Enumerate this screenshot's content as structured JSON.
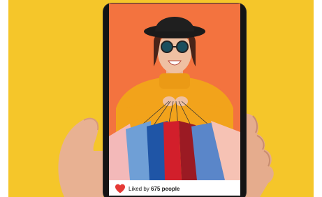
{
  "colors": {
    "background": "#f5c62a",
    "photo_background": "#f3733f",
    "heart": "#e53935"
  },
  "post": {
    "like_icon": "heart-icon",
    "liked_by_prefix": "Liked by",
    "liked_by_count": "675 people"
  }
}
